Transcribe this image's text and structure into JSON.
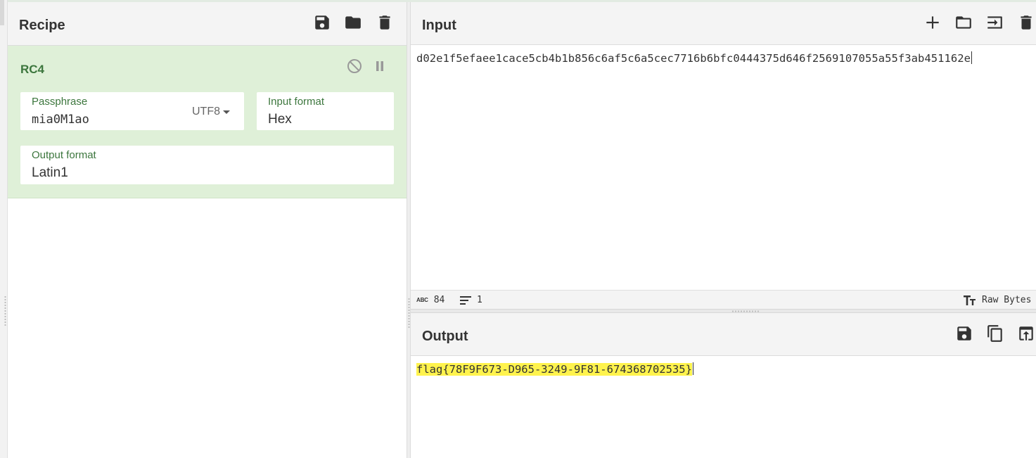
{
  "recipe": {
    "title": "Recipe",
    "operation": {
      "name": "RC4",
      "passphrase": {
        "label": "Passphrase",
        "value": "mia0M1ao",
        "encoding": "UTF8"
      },
      "input_format": {
        "label": "Input format",
        "value": "Hex"
      },
      "output_format": {
        "label": "Output format",
        "value": "Latin1"
      }
    },
    "icons": [
      "save-icon",
      "folder-icon",
      "trash-icon"
    ],
    "op_controls": [
      "disable-icon",
      "pause-icon"
    ]
  },
  "input": {
    "title": "Input",
    "text": "d02e1f5efaee1cace5cb4b1b856c6af5c6a5cec7716b6bfc0444375d646f2569107055a55f3ab451162e",
    "icons": [
      "plus-icon",
      "folder-icon",
      "load-icon",
      "trash-icon"
    ],
    "status": {
      "length_icon": "abc",
      "length": "84",
      "lines": "1",
      "encoding": "Raw Bytes"
    }
  },
  "output": {
    "title": "Output",
    "text": "flag{78F9F673-D965-3249-9F81-674368702535}",
    "icons": [
      "save-icon",
      "copy-icon",
      "replace-input-icon"
    ]
  },
  "colors": {
    "op_background": "#dff0d8",
    "op_text": "#3c763d",
    "highlight": "#fff34d"
  }
}
